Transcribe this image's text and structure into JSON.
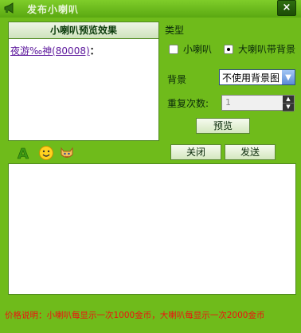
{
  "window": {
    "title": "发布小喇叭",
    "close_label": "×"
  },
  "preview": {
    "header": "小喇叭预览效果",
    "name": "夜游‰神(80008)",
    "colon": "："
  },
  "type": {
    "label": "类型",
    "option_small": "小喇叭",
    "option_big": "大喇叭带背景",
    "selected": "big"
  },
  "background": {
    "label": "背景",
    "value": "不使用背景图"
  },
  "repeat": {
    "label": "重复次数:",
    "value": "1"
  },
  "buttons": {
    "preview": "预览",
    "close": "关闭",
    "send": "发送"
  },
  "toolbar": {
    "font_icon": "A",
    "emoji_icon": "smiley",
    "special_icon": "cat-face"
  },
  "price_note": "价格说明：小喇叭每显示一次1000金币，大喇叭每显示一次2000金币"
}
